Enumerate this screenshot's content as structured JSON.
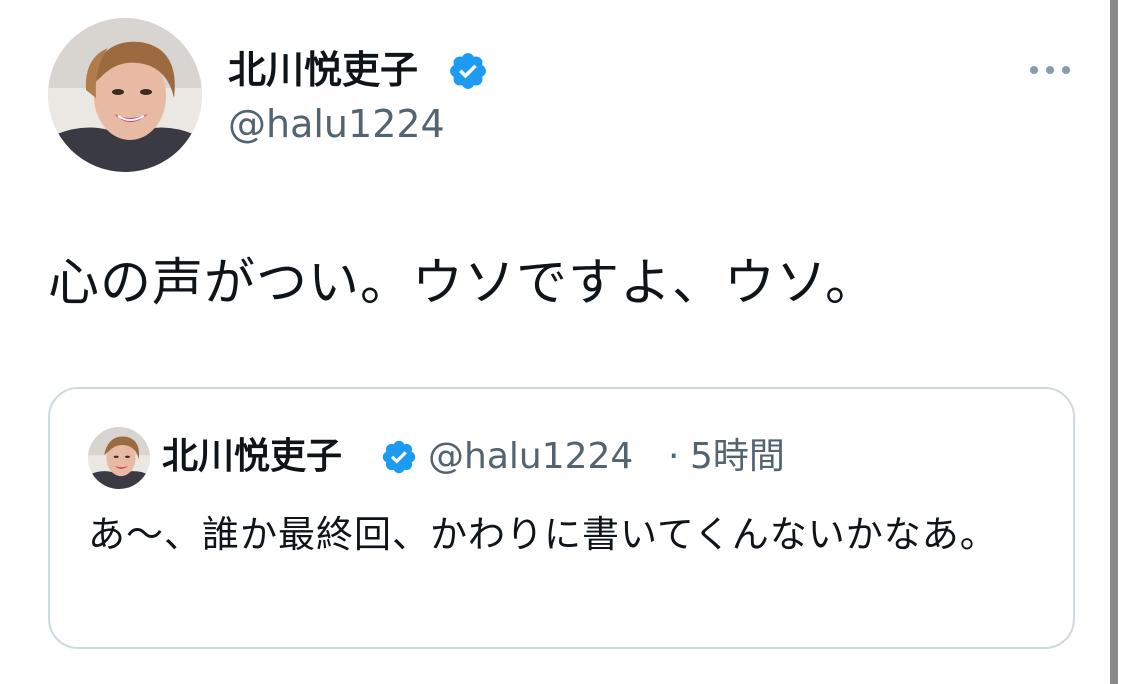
{
  "tweet": {
    "author_name": "北川悦吏子",
    "author_handle": "@halu1224",
    "text": "心の声がつい。ウソですよ、ウソ。"
  },
  "quoted_tweet": {
    "author_name": "北川悦吏子",
    "author_handle": "@halu1224",
    "separator": "·",
    "time": "5時間",
    "text": "あ〜、誰か最終回、かわりに書いてくんないかなあ。"
  },
  "icons": {
    "verified": "verified-badge-icon",
    "more": "more-options-icon"
  },
  "colors": {
    "verified_blue": "#1d9bf0",
    "secondary_text": "#536471",
    "border": "#cfd9de",
    "primary_text": "#0f1419"
  }
}
